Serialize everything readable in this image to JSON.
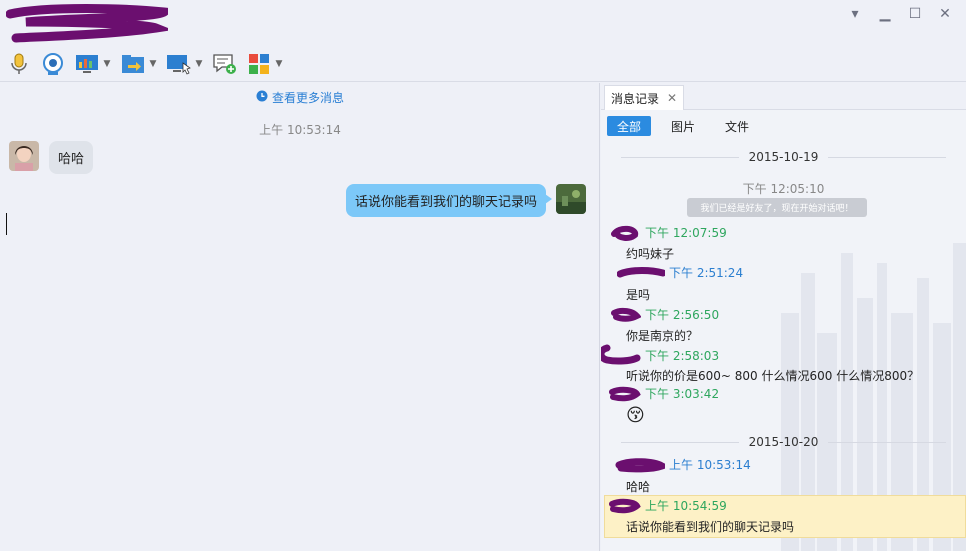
{
  "window": {
    "controls": {
      "menu": "▾",
      "minimize": "▁",
      "maximize": "☐",
      "close": "✕"
    }
  },
  "toolbar": {
    "icons": [
      "microphone-icon",
      "webcam-icon",
      "screen-share-icon",
      "file-transfer-icon",
      "remote-desktop-icon",
      "new-message-icon",
      "apps-icon"
    ]
  },
  "chat": {
    "more_messages": "查看更多消息",
    "time": "上午 10:53:14",
    "incoming_text": "哈哈",
    "outgoing_text": "话说你能看到我们的聊天记录吗"
  },
  "history": {
    "tab_label": "消息记录",
    "tab_close": "✕",
    "filters": [
      "全部",
      "图片",
      "文件"
    ],
    "dates": [
      "2015-10-19",
      "2015-10-20"
    ],
    "system_time": "下午 12:05:10",
    "system_note": "我们已经是好友了，现在开始对话吧！",
    "entries": [
      {
        "time": "下午 12:07:59",
        "text": "约吗妹子",
        "color": "green"
      },
      {
        "time": "下午 2:51:24",
        "text": "是吗",
        "color": "blue"
      },
      {
        "time": "下午 2:56:50",
        "text": "你是南京的？",
        "color": "green"
      },
      {
        "time": "下午 2:58:03",
        "text": "听说你的价是600~ 800 什么情况600 什么情况800？",
        "color": "green"
      },
      {
        "time": "下午 3:03:42",
        "text": "",
        "emoji": "😚",
        "color": "green"
      },
      {
        "time": "上午 10:53:14",
        "text": "哈哈",
        "color": "blue"
      },
      {
        "time": "上午 10:54:59",
        "text": "话说你能看到我们的聊天记录吗",
        "color": "green"
      }
    ]
  },
  "colors": {
    "accent": "#2b8be0",
    "outgoing_bubble": "#7cc8f8",
    "incoming_bubble": "#dfe3ea",
    "time_green": "#2ea65e",
    "time_blue": "#2c7fd0",
    "redaction": "#6b0f6f",
    "highlight": "#fdf1c6"
  }
}
